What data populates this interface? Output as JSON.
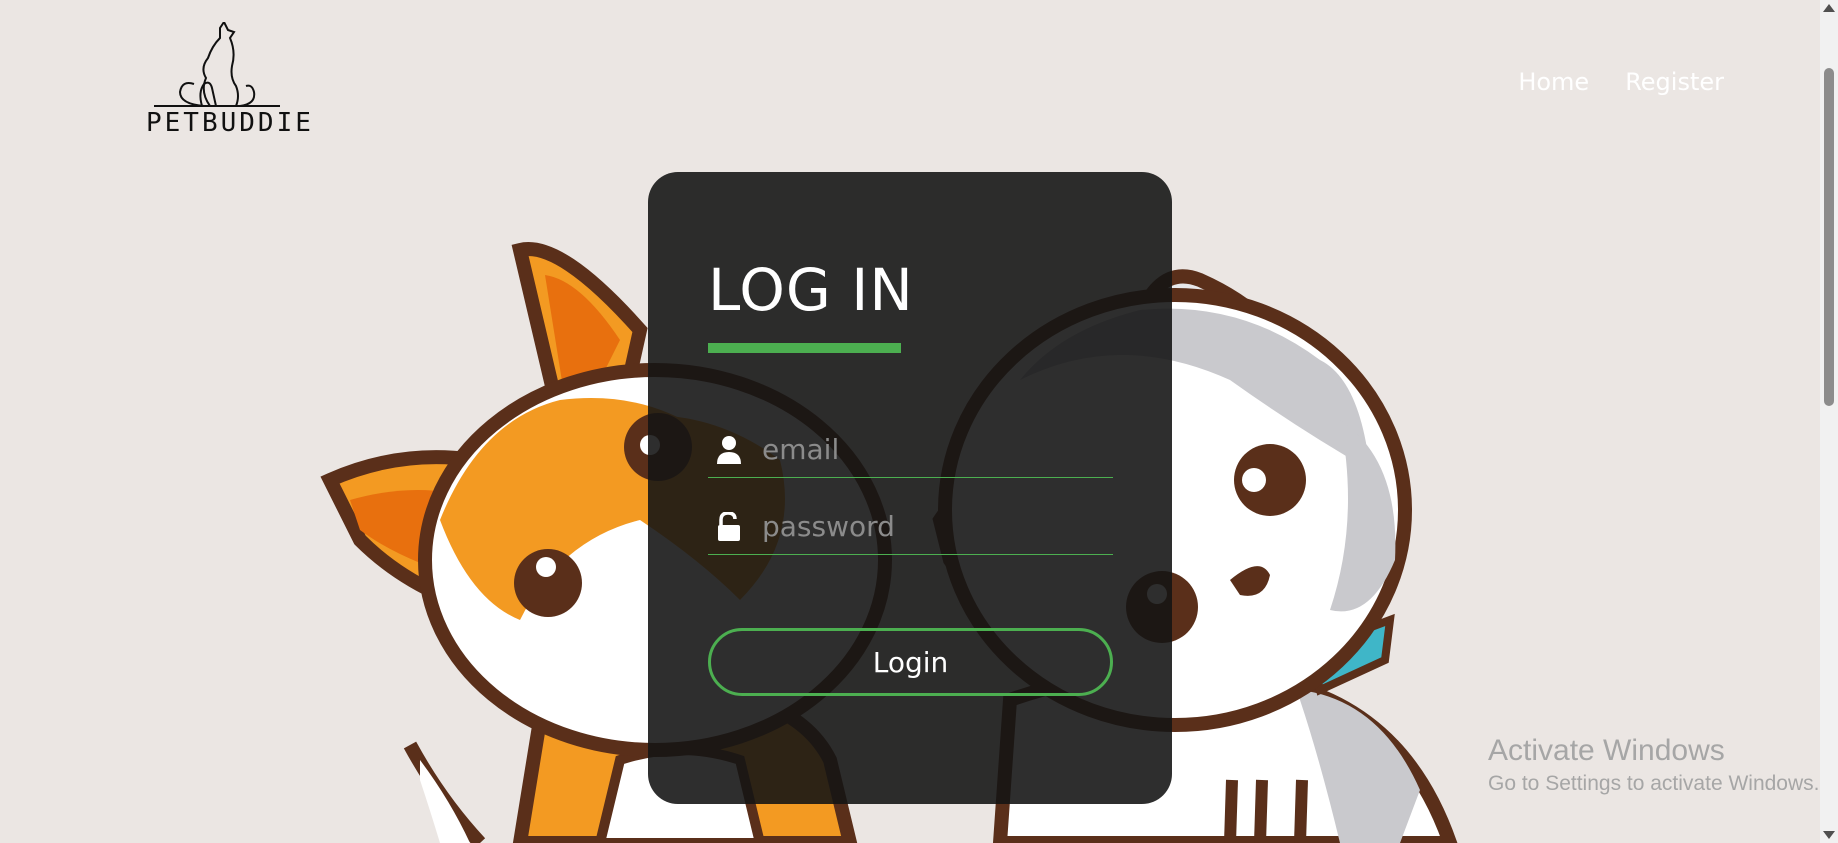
{
  "logo": {
    "text": "PETBUDDIE"
  },
  "nav": {
    "items": [
      {
        "label": "Home"
      },
      {
        "label": "Register"
      }
    ]
  },
  "login": {
    "title": "LOG IN",
    "email": {
      "placeholder": "email",
      "value": ""
    },
    "password": {
      "placeholder": "password",
      "value": ""
    },
    "button_label": "Login"
  },
  "watermark": {
    "title": "Activate Windows",
    "subtitle": "Go to Settings to activate Windows."
  },
  "colors": {
    "background": "#ebe6e3",
    "card": "#141414",
    "accent": "#4caf50",
    "text": "#ffffff"
  }
}
